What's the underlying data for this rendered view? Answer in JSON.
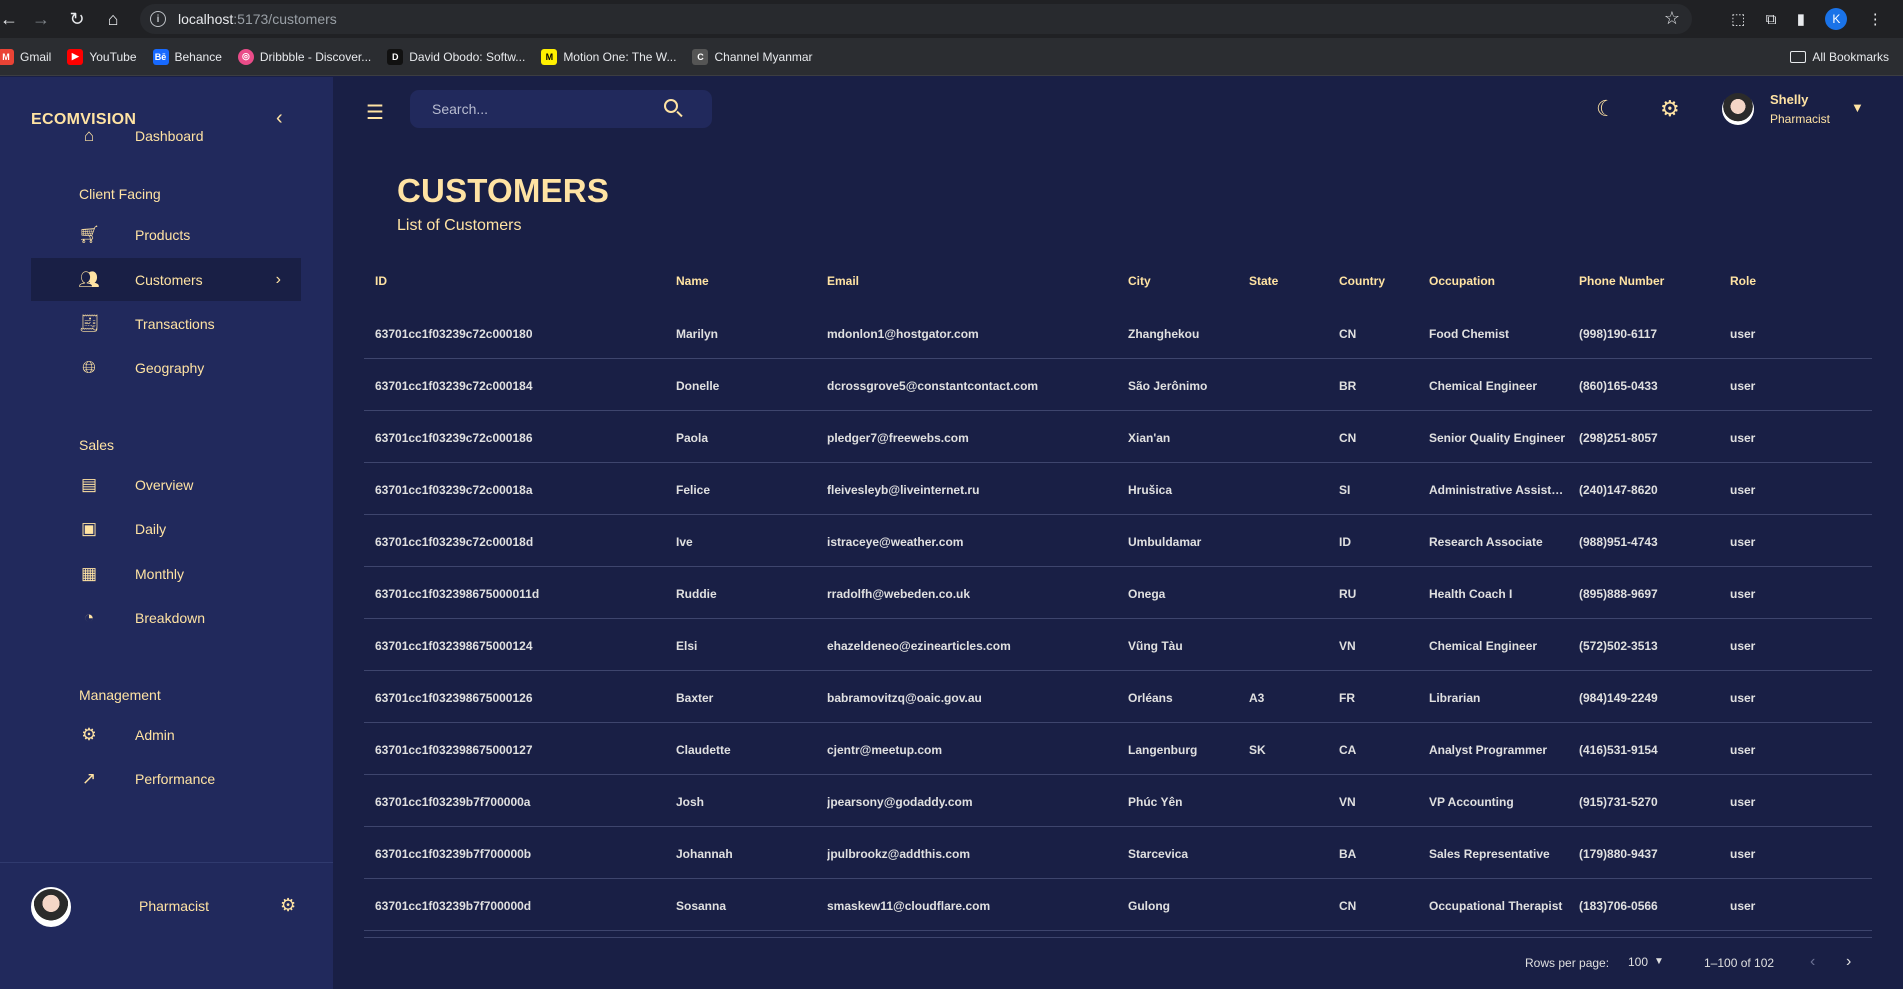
{
  "browser": {
    "url_host": "localhost",
    "url_path": ":5173/customers",
    "profile_initial": "K",
    "bookmarks": [
      {
        "label": "Gmail",
        "icon": "gmail-icon",
        "color": "#ea4335"
      },
      {
        "label": "YouTube",
        "icon": "youtube-icon",
        "color": "#ff0000"
      },
      {
        "label": "Behance",
        "icon": "behance-icon",
        "color": "#1769ff"
      },
      {
        "label": "Dribbble - Discover...",
        "icon": "dribbble-icon",
        "color": "#ea4c89"
      },
      {
        "label": "David Obodo: Softw...",
        "icon": "site-icon",
        "color": "#111111"
      },
      {
        "label": "Motion One: The W...",
        "icon": "motion-icon",
        "color": "#fff000"
      },
      {
        "label": "Channel Myanmar",
        "icon": "channel-icon",
        "color": "#555555"
      }
    ],
    "all_bookmarks": "All Bookmarks"
  },
  "sidebar": {
    "brand": "ECOMVISION",
    "items": [
      {
        "label": "Dashboard",
        "icon": "home-icon"
      },
      {
        "section": "Client Facing"
      },
      {
        "label": "Products",
        "icon": "cart-icon"
      },
      {
        "label": "Customers",
        "icon": "groups-icon",
        "active": true
      },
      {
        "label": "Transactions",
        "icon": "receipt-icon"
      },
      {
        "label": "Geography",
        "icon": "globe-icon"
      },
      {
        "section": "Sales"
      },
      {
        "label": "Overview",
        "icon": "point-of-sale-icon"
      },
      {
        "label": "Daily",
        "icon": "calendar-today-icon"
      },
      {
        "label": "Monthly",
        "icon": "calendar-month-icon"
      },
      {
        "label": "Breakdown",
        "icon": "pie-chart-icon"
      },
      {
        "section": "Management"
      },
      {
        "label": "Admin",
        "icon": "admin-icon"
      },
      {
        "label": "Performance",
        "icon": "trending-up-icon"
      }
    ],
    "user_name": "Pharmacist"
  },
  "topbar": {
    "search_placeholder": "Search...",
    "user_name": "Shelly",
    "user_role": "Pharmacist"
  },
  "header": {
    "title": "CUSTOMERS",
    "subtitle": "List of Customers"
  },
  "table": {
    "columns": [
      "ID",
      "Name",
      "Email",
      "City",
      "State",
      "Country",
      "Occupation",
      "Phone Number",
      "Role"
    ],
    "rows": [
      [
        "63701cc1f03239c72c000180",
        "Marilyn",
        "mdonlon1@hostgator.com",
        "Zhanghekou",
        "",
        "CN",
        "Food Chemist",
        "(998)190-6117",
        "user"
      ],
      [
        "63701cc1f03239c72c000184",
        "Donelle",
        "dcrossgrove5@constantcontact.com",
        "São Jerônimo",
        "",
        "BR",
        "Chemical Engineer",
        "(860)165-0433",
        "user"
      ],
      [
        "63701cc1f03239c72c000186",
        "Paola",
        "pledger7@freewebs.com",
        "Xian'an",
        "",
        "CN",
        "Senior Quality Engineer",
        "(298)251-8057",
        "user"
      ],
      [
        "63701cc1f03239c72c00018a",
        "Felice",
        "fleivesleyb@liveinternet.ru",
        "Hrušica",
        "",
        "SI",
        "Administrative Assistant",
        "(240)147-8620",
        "user"
      ],
      [
        "63701cc1f03239c72c00018d",
        "Ive",
        "istraceye@weather.com",
        "Umbuldamar",
        "",
        "ID",
        "Research Associate",
        "(988)951-4743",
        "user"
      ],
      [
        "63701cc1f032398675000011d",
        "Ruddie",
        "rradolfh@webeden.co.uk",
        "Onega",
        "",
        "RU",
        "Health Coach I",
        "(895)888-9697",
        "user"
      ],
      [
        "63701cc1f032398675000124",
        "Elsi",
        "ehazeldeneo@ezinearticles.com",
        "Vũng Tàu",
        "",
        "VN",
        "Chemical Engineer",
        "(572)502-3513",
        "user"
      ],
      [
        "63701cc1f032398675000126",
        "Baxter",
        "babramovitzq@oaic.gov.au",
        "Orléans",
        "A3",
        "FR",
        "Librarian",
        "(984)149-2249",
        "user"
      ],
      [
        "63701cc1f032398675000127",
        "Claudette",
        "cjentr@meetup.com",
        "Langenburg",
        "SK",
        "CA",
        "Analyst Programmer",
        "(416)531-9154",
        "user"
      ],
      [
        "63701cc1f03239b7f700000a",
        "Josh",
        "jpearsony@godaddy.com",
        "Phúc Yên",
        "",
        "VN",
        "VP Accounting",
        "(915)731-5270",
        "user"
      ],
      [
        "63701cc1f03239b7f700000b",
        "Johannah",
        "jpulbrookz@addthis.com",
        "Starcevica",
        "",
        "BA",
        "Sales Representative",
        "(179)880-9437",
        "user"
      ],
      [
        "63701cc1f03239b7f700000d",
        "Sosanna",
        "smaskew11@cloudflare.com",
        "Gulong",
        "",
        "CN",
        "Occupational Therapist",
        "(183)706-0566",
        "user"
      ]
    ]
  },
  "pagination": {
    "rows_per_page_label": "Rows per page:",
    "rows_per_page": "100",
    "range": "1–100 of 102"
  },
  "colors": {
    "background": "#191f45",
    "sidebar": "#21295c",
    "accent": "#ffe3a3"
  }
}
